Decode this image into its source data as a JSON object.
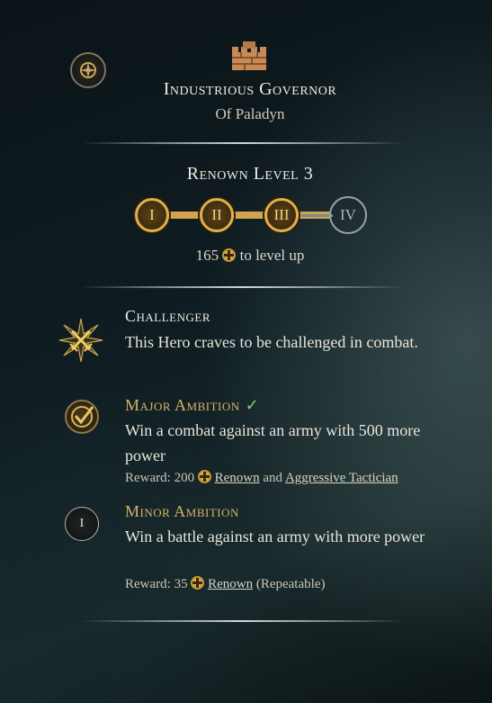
{
  "header": {
    "title": "Industrious Governor",
    "subtitle": "Of Paladyn"
  },
  "renown": {
    "title": "Renown Level 3",
    "levels": [
      "I",
      "II",
      "III",
      "IV"
    ],
    "levels_completed": 3,
    "points_needed": "165",
    "to_level_up": "to level up"
  },
  "traits": [
    {
      "icon": "crossed-swords-icon",
      "title": "Challenger",
      "description": "This Hero craves to be challenged in combat."
    }
  ],
  "ambitions": [
    {
      "icon": "checkmark-badge-icon",
      "title": "Major Ambition",
      "completed": true,
      "description": "Win a combat against an army with 500 more power",
      "reward_label": "Reward: 200",
      "reward_link_1": "Renown",
      "reward_and": "and",
      "reward_link_2": "Aggressive Tactician"
    },
    {
      "icon_text": "I",
      "title": "Minor Ambition",
      "description": "Win a battle against an army with more power",
      "reward_label": "Reward: 35",
      "reward_link_1": "Renown",
      "reward_suffix": "(Repeatable)"
    }
  ],
  "colors": {
    "gold": "#d6b36a",
    "level_done": "#e0b04e",
    "check": "#7fcf73"
  }
}
